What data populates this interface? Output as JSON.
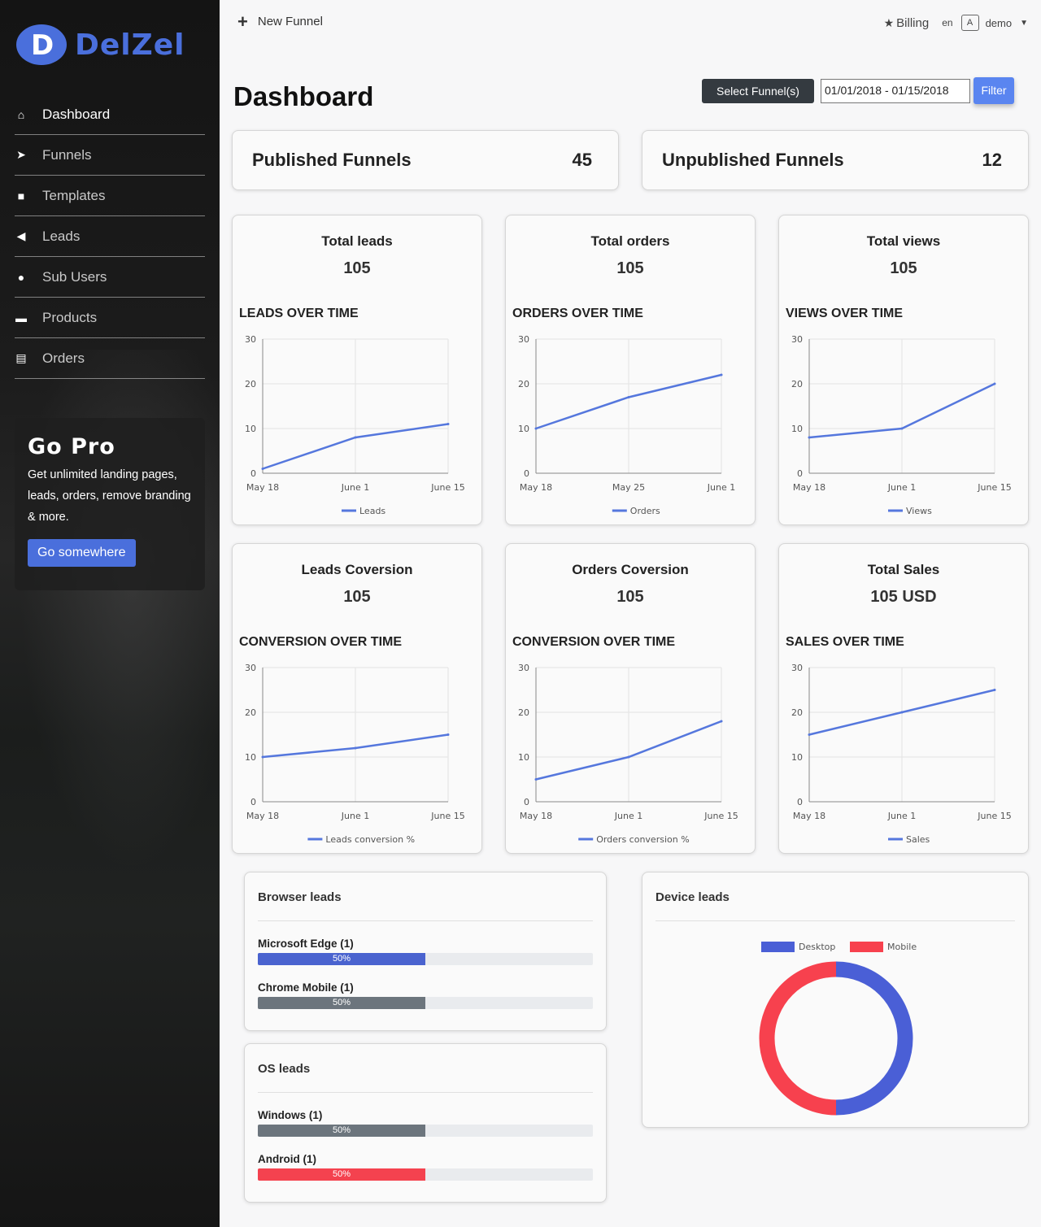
{
  "brand": {
    "name": "DelZel"
  },
  "sidebar": {
    "items": [
      {
        "label": "Dashboard",
        "icon": "home-icon",
        "glyph": "⌂",
        "active": true
      },
      {
        "label": "Funnels",
        "icon": "paper-plane-icon",
        "glyph": "➤"
      },
      {
        "label": "Templates",
        "icon": "sticky-note-icon",
        "glyph": "■"
      },
      {
        "label": "Leads",
        "icon": "bullhorn-icon",
        "glyph": "◀"
      },
      {
        "label": "Sub Users",
        "icon": "user-icon",
        "glyph": "●"
      },
      {
        "label": "Products",
        "icon": "shopping-bag-icon",
        "glyph": "▬"
      },
      {
        "label": "Orders",
        "icon": "shopping-cart-icon",
        "glyph": "▤"
      }
    ],
    "promo": {
      "title": "Go Pro",
      "text": "Get unlimited landing pages, leads, orders, remove branding & more.",
      "button": "Go somewhere"
    }
  },
  "topbar": {
    "new_funnel": "New Funnel",
    "billing": "Billing",
    "lang": "en",
    "user": "demo"
  },
  "header": {
    "title": "Dashboard",
    "select_funnel": "Select Funnel(s)",
    "date_range": "01/01/2018 - 01/15/2018",
    "filter": "Filter"
  },
  "summary": {
    "published": {
      "label": "Published Funnels",
      "value": "45"
    },
    "unpublished": {
      "label": "Unpublished Funnels",
      "value": "12"
    }
  },
  "accent": "#5577dd",
  "stats": [
    {
      "label": "Total leads",
      "value": "105",
      "chart_title": "LEADS OVER TIME"
    },
    {
      "label": "Total orders",
      "value": "105",
      "chart_title": "ORDERS OVER TIME"
    },
    {
      "label": "Total views",
      "value": "105",
      "chart_title": "VIEWS OVER TIME"
    },
    {
      "label": "Leads Coversion",
      "value": "105",
      "chart_title": "CONVERSION OVER TIME"
    },
    {
      "label": "Orders Coversion",
      "value": "105",
      "chart_title": "CONVERSION OVER TIME"
    },
    {
      "label": "Total Sales",
      "value": "105 USD",
      "chart_title": "SALES OVER TIME"
    }
  ],
  "browser_leads": {
    "title": "Browser leads",
    "rows": [
      {
        "label": "Microsoft Edge (1)",
        "percent": 50,
        "text": "50%",
        "color": "#4a63cf"
      },
      {
        "label": "Chrome Mobile (1)",
        "percent": 50,
        "text": "50%",
        "color": "#6c757d"
      }
    ]
  },
  "os_leads": {
    "title": "OS leads",
    "rows": [
      {
        "label": "Windows (1)",
        "percent": 50,
        "text": "50%",
        "color": "#6c757d"
      },
      {
        "label": "Android (1)",
        "percent": 50,
        "text": "50%",
        "color": "#f4424f"
      }
    ]
  },
  "device_leads": {
    "title": "Device leads"
  },
  "chart_data": [
    {
      "type": "line",
      "x": [
        "May 18",
        "June 1",
        "June 15"
      ],
      "yticks": [
        "0",
        "10",
        "20",
        "30"
      ],
      "ylim": [
        0,
        30
      ],
      "series": [
        {
          "name": "Leads",
          "values": [
            1,
            8,
            11
          ]
        }
      ],
      "grid": true,
      "legend": "bottom"
    },
    {
      "type": "line",
      "x": [
        "May 18",
        "May 25",
        "June 1"
      ],
      "yticks": [
        "0",
        "10",
        "20",
        "30"
      ],
      "ylim": [
        0,
        30
      ],
      "series": [
        {
          "name": "Orders",
          "values": [
            10,
            17,
            22
          ]
        }
      ],
      "grid": true,
      "legend": "bottom"
    },
    {
      "type": "line",
      "x": [
        "May 18",
        "June 1",
        "June 15"
      ],
      "yticks": [
        "0",
        "10",
        "20",
        "30"
      ],
      "ylim": [
        0,
        30
      ],
      "series": [
        {
          "name": "Views",
          "values": [
            8,
            10,
            20
          ]
        }
      ],
      "grid": true,
      "legend": "bottom"
    },
    {
      "type": "line",
      "x": [
        "May 18",
        "June 1",
        "June 15"
      ],
      "yticks": [
        "0",
        "10",
        "20",
        "30"
      ],
      "ylim": [
        0,
        30
      ],
      "series": [
        {
          "name": "Leads conversion %",
          "values": [
            10,
            12,
            15
          ]
        }
      ],
      "grid": true,
      "legend": "bottom"
    },
    {
      "type": "line",
      "x": [
        "May 18",
        "June 1",
        "June 15"
      ],
      "yticks": [
        "0",
        "10",
        "20",
        "30"
      ],
      "ylim": [
        0,
        30
      ],
      "series": [
        {
          "name": "Orders conversion %",
          "values": [
            5,
            10,
            18
          ]
        }
      ],
      "grid": true,
      "legend": "bottom"
    },
    {
      "type": "line",
      "x": [
        "May 18",
        "June 1",
        "June 15"
      ],
      "yticks": [
        "0",
        "10",
        "20",
        "30"
      ],
      "ylim": [
        0,
        30
      ],
      "series": [
        {
          "name": "Sales",
          "values": [
            15,
            20,
            25
          ]
        }
      ],
      "grid": true,
      "legend": "bottom"
    },
    {
      "type": "pie",
      "donut": true,
      "categories": [
        "Desktop",
        "Mobile"
      ],
      "values": [
        50,
        50
      ],
      "colors": [
        "#4a5fd6",
        "#f7414e"
      ],
      "legend": "top"
    }
  ]
}
